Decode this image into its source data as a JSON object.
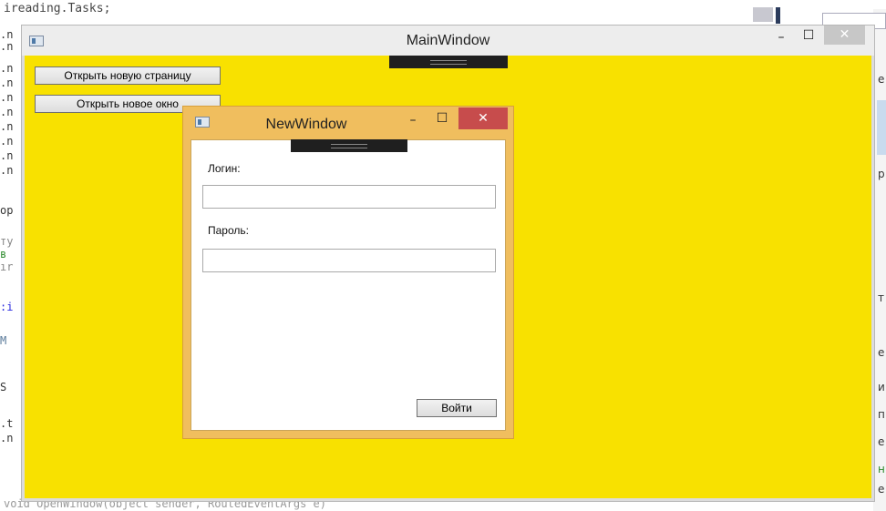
{
  "editor": {
    "top_line": "ireading.Tasks;",
    "left_fragments": [
      ".n",
      ".n",
      ".n",
      ".n",
      ".n",
      ".n",
      ".n",
      ".n",
      ".n",
      ".n",
      "ор",
      "ту",
      " в",
      "ır",
      ":i",
      " М",
      " S",
      ".t",
      ".n"
    ],
    "right_fragments": [
      "e",
      "p",
      "т",
      "e",
      "и",
      "п",
      "e",
      "н",
      "e"
    ],
    "bottom_line": "void OpenWindow(object sender, RoutedEventArgs e)"
  },
  "main_window": {
    "title": "MainWindow",
    "minimize_glyph": "–",
    "maximize_glyph": "☐",
    "close_glyph": "✕",
    "open_page_button": "Открыть новую страницу",
    "open_window_button": "Открыть новое окно",
    "background_color": "#f8e100"
  },
  "new_window": {
    "title": "NewWindow",
    "minimize_glyph": "–",
    "maximize_glyph": "☐",
    "close_glyph": "✕",
    "login_label": "Логин:",
    "login_value": "",
    "password_label": "Пароль:",
    "password_value": "",
    "submit_button": "Войти",
    "frame_color": "#f0be5e",
    "close_color": "#c74c4c"
  },
  "icons": {
    "app_icon": "window-app-icon",
    "minimize": "minimize-icon",
    "maximize": "maximize-icon",
    "close": "close-icon"
  }
}
